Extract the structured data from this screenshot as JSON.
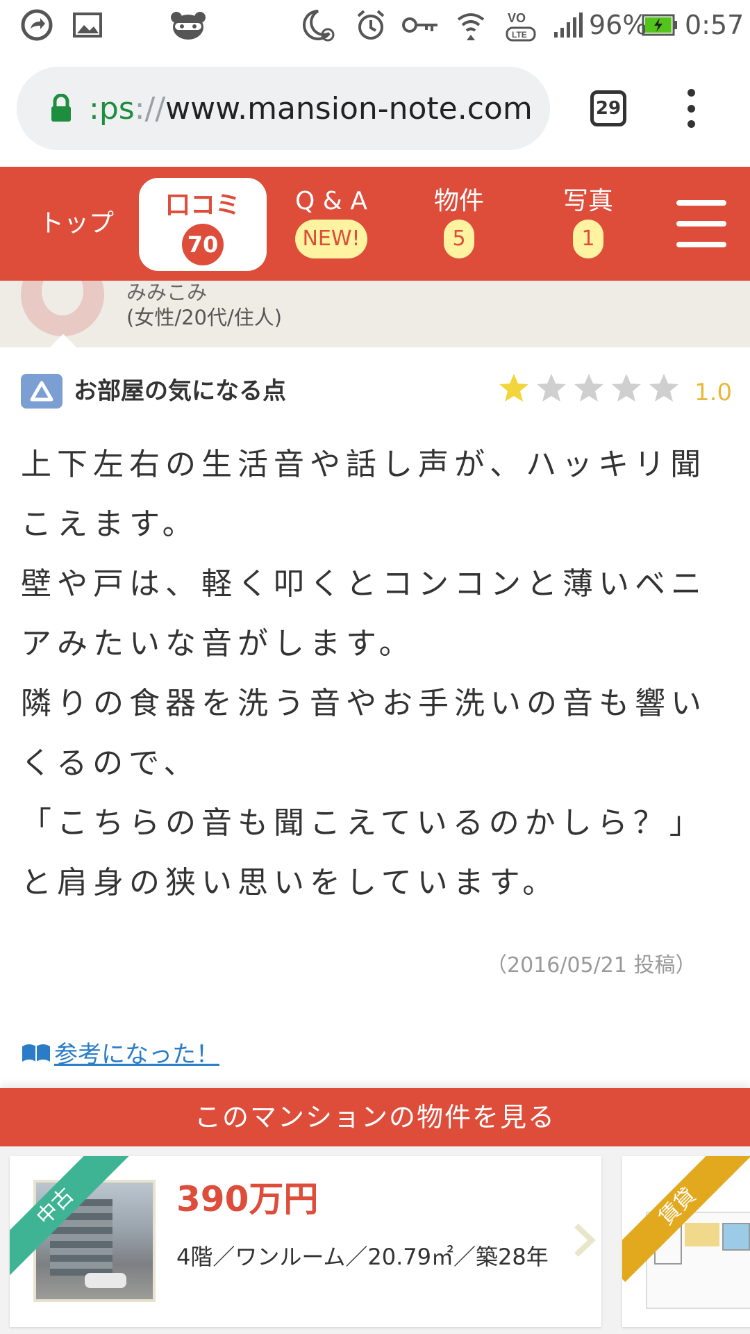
{
  "status_bar": {
    "battery": "96%",
    "time": "0:57"
  },
  "browser": {
    "url_scheme": ":ps",
    "url_slashes": "://",
    "url_host": "www.mansion-note.com",
    "tab_count": "29"
  },
  "nav": {
    "top": "トップ",
    "reviews_label": "口コミ",
    "reviews_count": "70",
    "qa_label": "Q & A",
    "qa_badge": "NEW!",
    "listings_label": "物件",
    "listings_count": "5",
    "photos_label": "写真",
    "photos_count": "1"
  },
  "reviewer": {
    "name": "みみこみ",
    "meta": "(女性/20代/住人)"
  },
  "review": {
    "title": "お部屋の気になる点",
    "rating": "1.0",
    "rating_value": 1,
    "rating_max": 5,
    "lines": [
      "上下左右の生活音や話し声が、ハッキリ聞",
      "こえます。",
      "壁や戸は、軽く叩くとコンコンと薄いベニ",
      "アみたいな音がします。",
      "隣りの食器を洗う音やお手洗いの音も響い",
      "くるので、",
      "「こちらの音も聞こえているのかしら？」",
      "と肩身の狭い思いをしています。"
    ],
    "posted": "（2016/05/21 投稿）",
    "helpful_link": "参考になった！"
  },
  "listings": {
    "banner": "このマンションの物件を見る",
    "cards": [
      {
        "tag": "中古",
        "price": "390万円",
        "desc": "4階／ワンルーム／20.79㎡／築28年"
      },
      {
        "tag": "賃貸"
      }
    ]
  },
  "colors": {
    "brand_red": "#de4c3a",
    "star_on": "#f2d53c",
    "star_off": "#cfcfcf",
    "rating_text": "#e8b83a",
    "link_blue": "#2a7cc7",
    "used_ribbon": "#3fb494",
    "rent_ribbon": "#e3a91e"
  }
}
